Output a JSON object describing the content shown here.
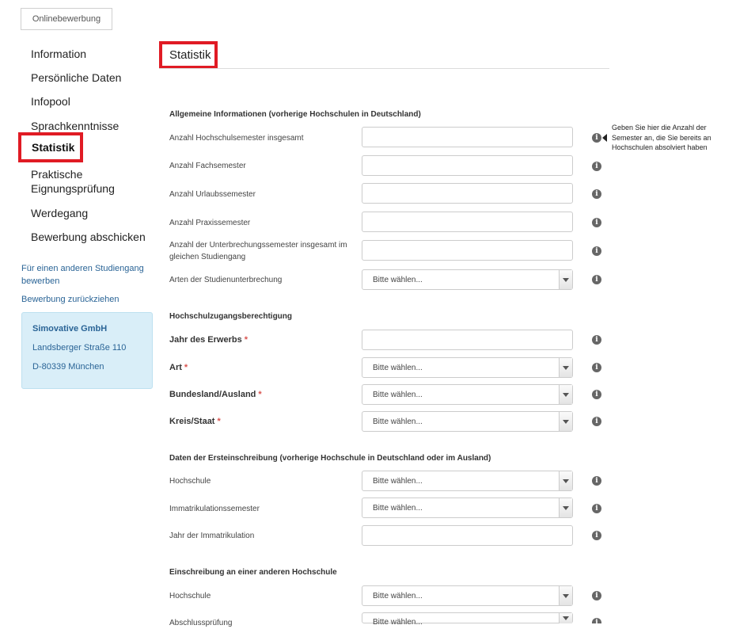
{
  "top_tab": {
    "label": "Onlinebewerbung"
  },
  "sidebar": {
    "items": [
      {
        "label": "Information"
      },
      {
        "label": "Persönliche Daten"
      },
      {
        "label": "Infopool"
      },
      {
        "label": "Sprachkenntnisse"
      },
      {
        "label": "Statistik",
        "active": true
      },
      {
        "label": "Praktische Eignungsprüfung"
      },
      {
        "label": "Werdegang"
      },
      {
        "label": "Bewerbung abschicken"
      }
    ],
    "links": [
      {
        "label": "Für einen anderen Studiengang bewerben"
      },
      {
        "label": "Bewerbung zurückziehen"
      }
    ],
    "address": {
      "company": "Simovative GmbH",
      "street": "Landsberger Straße 110",
      "city": "D-80339 München"
    }
  },
  "main": {
    "heading": "Statistik",
    "select_placeholder": "Bitte wählen...",
    "required_marker": "*",
    "info_glyph": "i",
    "tooltip": "Geben Sie hier die Anzahl der Semester an, die Sie bereits an Hochschulen absolviert haben",
    "sections": [
      {
        "title": "Allgemeine Informationen (vorherige Hochschulen in Deutschland)",
        "fields": [
          {
            "label": "Anzahl Hochschulsemester insgesamt",
            "type": "text"
          },
          {
            "label": "Anzahl Fachsemester",
            "type": "text"
          },
          {
            "label": "Anzahl Urlaubssemester",
            "type": "text"
          },
          {
            "label": "Anzahl Praxissemester",
            "type": "text"
          },
          {
            "label": "Anzahl der Unterbrechungssemester insgesamt im gleichen Studiengang",
            "type": "text"
          },
          {
            "label": "Arten der Studienunterbrechung",
            "type": "select"
          }
        ]
      },
      {
        "title": "Hochschulzugangsberechtigung",
        "fields": [
          {
            "label": "Jahr des Erwerbs",
            "type": "text",
            "required": true
          },
          {
            "label": "Art",
            "type": "select",
            "required": true
          },
          {
            "label": "Bundesland/Ausland",
            "type": "select",
            "required": true
          },
          {
            "label": "Kreis/Staat",
            "type": "select",
            "required": true
          }
        ]
      },
      {
        "title": "Daten der Ersteinschreibung (vorherige Hochschule in Deutschland oder im Ausland)",
        "fields": [
          {
            "label": "Hochschule",
            "type": "select"
          },
          {
            "label": "Immatrikulationssemester",
            "type": "select"
          },
          {
            "label": "Jahr der Immatrikulation",
            "type": "text"
          }
        ]
      },
      {
        "title": "Einschreibung an einer anderen Hochschule",
        "fields": [
          {
            "label": "Hochschule",
            "type": "select"
          },
          {
            "label": "Abschlussprüfung",
            "type": "select"
          }
        ]
      }
    ]
  }
}
